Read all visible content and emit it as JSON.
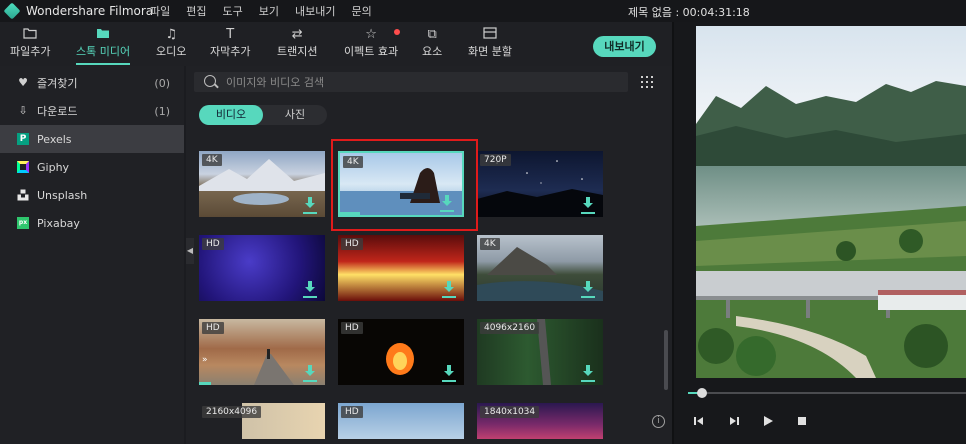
{
  "app": {
    "title": "Wondershare Filmora",
    "project_title": "제목 없음 : 00:04:31:18"
  },
  "menu": [
    "파일",
    "편집",
    "도구",
    "보기",
    "내보내기",
    "문의"
  ],
  "toolbar": {
    "items": [
      {
        "label": "파일추가",
        "icon": "folder-icon"
      },
      {
        "label": "스톡 미디어",
        "icon": "stock-media-icon"
      },
      {
        "label": "오디오",
        "icon": "music-note-icon"
      },
      {
        "label": "자막추가",
        "icon": "text-icon"
      },
      {
        "label": "트랜지션",
        "icon": "transition-icon"
      },
      {
        "label": "이펙트 효과",
        "icon": "effects-icon"
      },
      {
        "label": "요소",
        "icon": "elements-icon"
      },
      {
        "label": "화면 분할",
        "icon": "split-screen-icon"
      }
    ],
    "export_label": "내보내기"
  },
  "sidebar": {
    "items": [
      {
        "label": "즐겨찾기",
        "count": "(0)",
        "icon": "heart-icon"
      },
      {
        "label": "다운로드",
        "count": "(1)",
        "icon": "download-icon"
      },
      {
        "label": "Pexels",
        "count": "",
        "icon": "pexels-icon"
      },
      {
        "label": "Giphy",
        "count": "",
        "icon": "giphy-icon"
      },
      {
        "label": "Unsplash",
        "count": "",
        "icon": "unsplash-icon"
      },
      {
        "label": "Pixabay",
        "count": "",
        "icon": "pixabay-icon"
      }
    ]
  },
  "search": {
    "placeholder": "이미지와 비디오 검색"
  },
  "tabs": {
    "video": "비디오",
    "photo": "사진"
  },
  "media": [
    {
      "badge": "4K"
    },
    {
      "badge": "4K"
    },
    {
      "badge": "720P"
    },
    {
      "badge": "HD"
    },
    {
      "badge": "HD"
    },
    {
      "badge": "4K"
    },
    {
      "badge": "HD"
    },
    {
      "badge": "HD"
    },
    {
      "badge": "4096x2160"
    },
    {
      "badge": "2160x4096"
    },
    {
      "badge": "HD"
    },
    {
      "badge": "1840x1034"
    }
  ],
  "info_symbol": "i",
  "colors": {
    "accent": "#57d8bd",
    "highlight": "#e01b1b"
  }
}
